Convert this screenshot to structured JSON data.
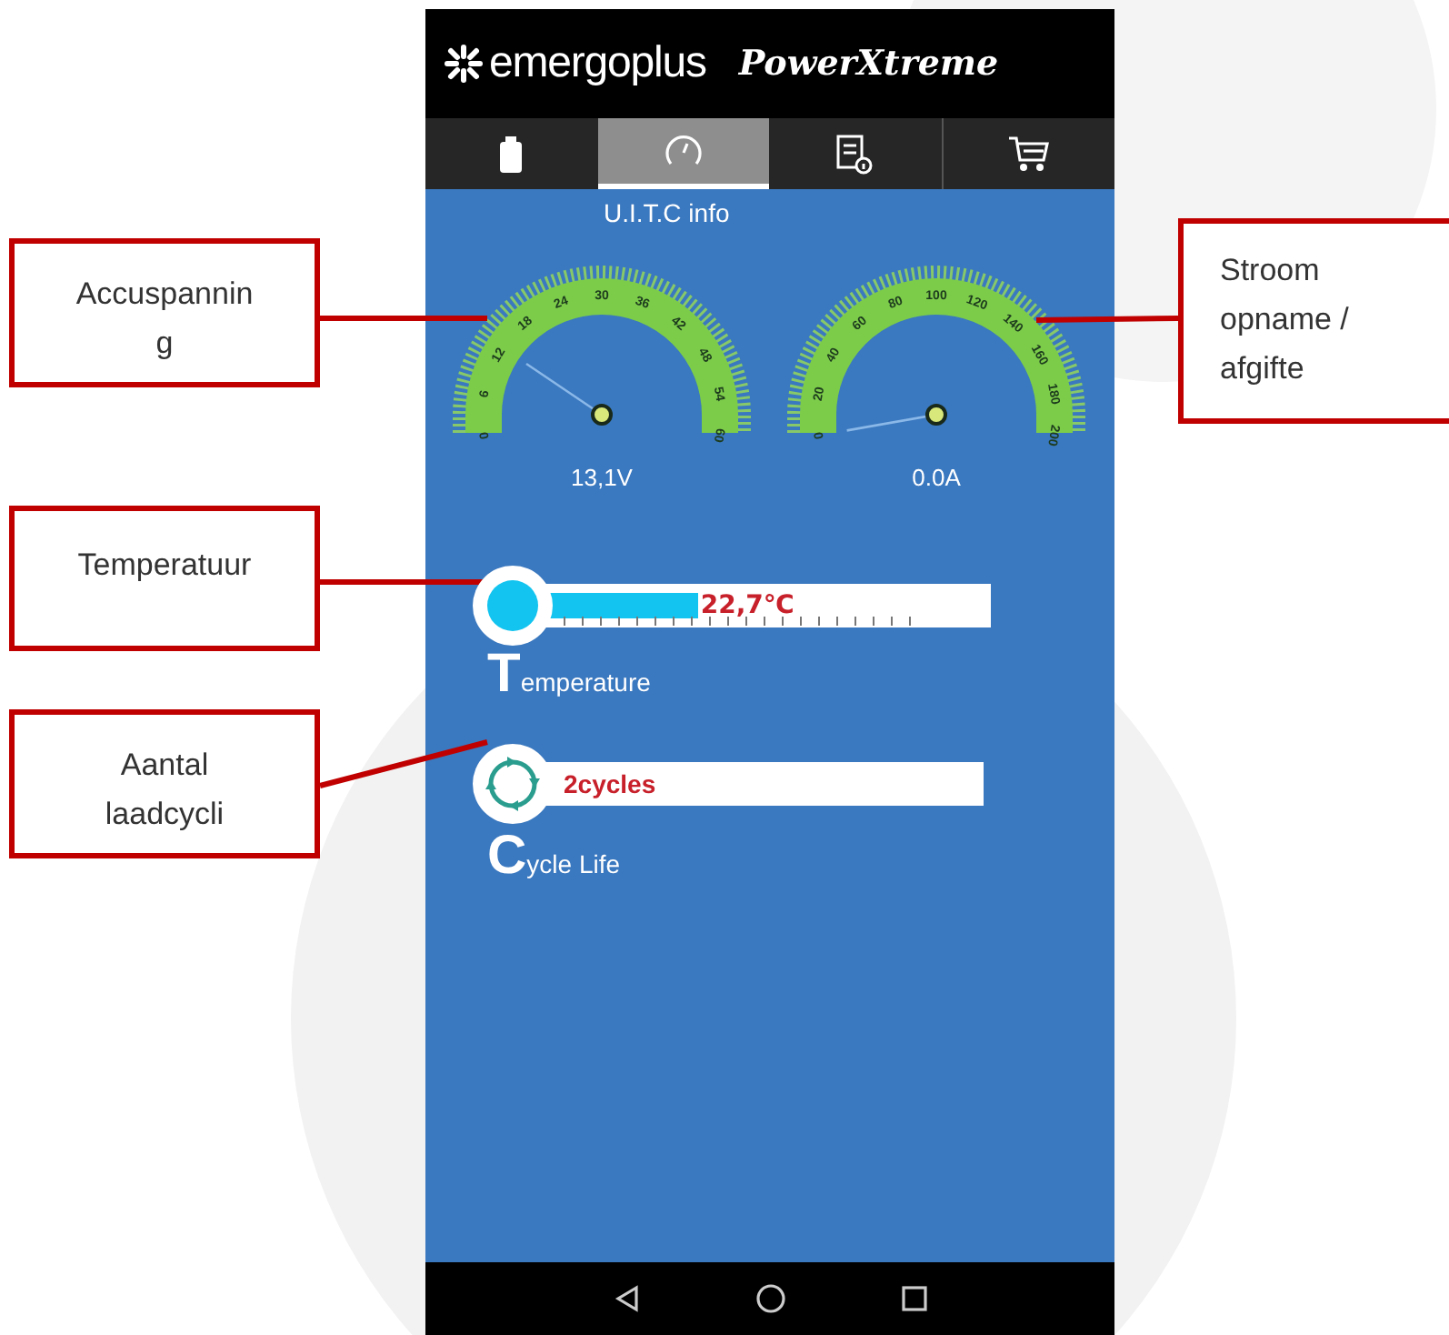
{
  "header": {
    "brand": "emergoplus",
    "product": "PowerXtreme"
  },
  "tabs": [
    {
      "kind": "battery",
      "selected": false
    },
    {
      "kind": "gauge",
      "selected": true
    },
    {
      "kind": "info",
      "selected": false
    },
    {
      "kind": "cart",
      "selected": false
    }
  ],
  "screen_title": "U.I.T.C info",
  "gauges": [
    {
      "ticks": [
        "0",
        "6",
        "12",
        "18",
        "24",
        "30",
        "36",
        "42",
        "48",
        "54",
        "60"
      ],
      "reading": "13,1V"
    },
    {
      "ticks": [
        "0",
        "20",
        "40",
        "60",
        "80",
        "100",
        "120",
        "140",
        "160",
        "180",
        "200"
      ],
      "reading": "0.0A"
    }
  ],
  "temperature": {
    "level": 0.37,
    "reading": "22,7℃",
    "label": "Temperature"
  },
  "cycles": {
    "reading": "2cycles",
    "label": "Cycle Life"
  },
  "nav_buttons": [
    {
      "kind": "back"
    },
    {
      "kind": "home"
    },
    {
      "kind": "recent"
    }
  ],
  "callouts": [
    {
      "text": "Accuspannin\ng"
    },
    {
      "text": "Stroom\nopname  /\nafgifte"
    },
    {
      "text": "Temperatuur"
    },
    {
      "text": "Aantal\nlaadcycli"
    }
  ]
}
